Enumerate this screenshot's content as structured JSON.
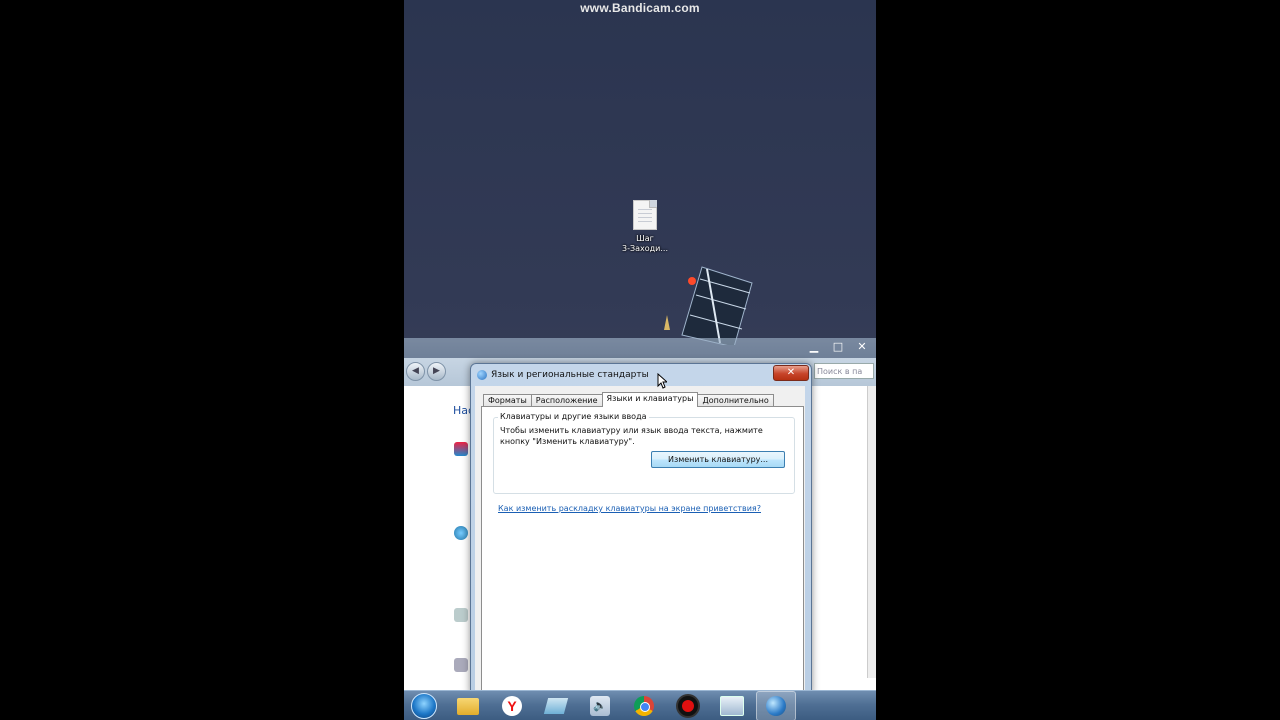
{
  "watermark": "www.Bandicam.com",
  "desktop": {
    "icon_label_line1": "Шаг",
    "icon_label_line2": "3-Заходи..."
  },
  "bg_window": {
    "caption_buttons": [
      "▁",
      "□",
      "✕"
    ],
    "search_placeholder": "Поиск в па",
    "link_fragment": "Нас"
  },
  "dialog": {
    "title": "Язык и региональные стандарты",
    "close_label": "✕",
    "tabs": [
      "Форматы",
      "Расположение",
      "Языки и клавиатуры",
      "Дополнительно"
    ],
    "active_tab_index": 2,
    "group_title": "Клавиатуры и другие языки ввода",
    "group_desc": "Чтобы изменить клавиатуру или язык ввода текста, нажмите кнопку \"Изменить клавиатуру\".",
    "change_keyboard_button": "Изменить клавиатуру...",
    "welcome_link": "Как изменить раскладку клавиатуры на экране приветствия?"
  },
  "taskbar": {
    "items": [
      "start",
      "explorer",
      "yandex",
      "notes",
      "volume",
      "chrome",
      "bandicam",
      "control-panel",
      "region-settings"
    ],
    "yandex_letter": "Y",
    "volume_glyph": "🔈",
    "active_index": 8
  }
}
